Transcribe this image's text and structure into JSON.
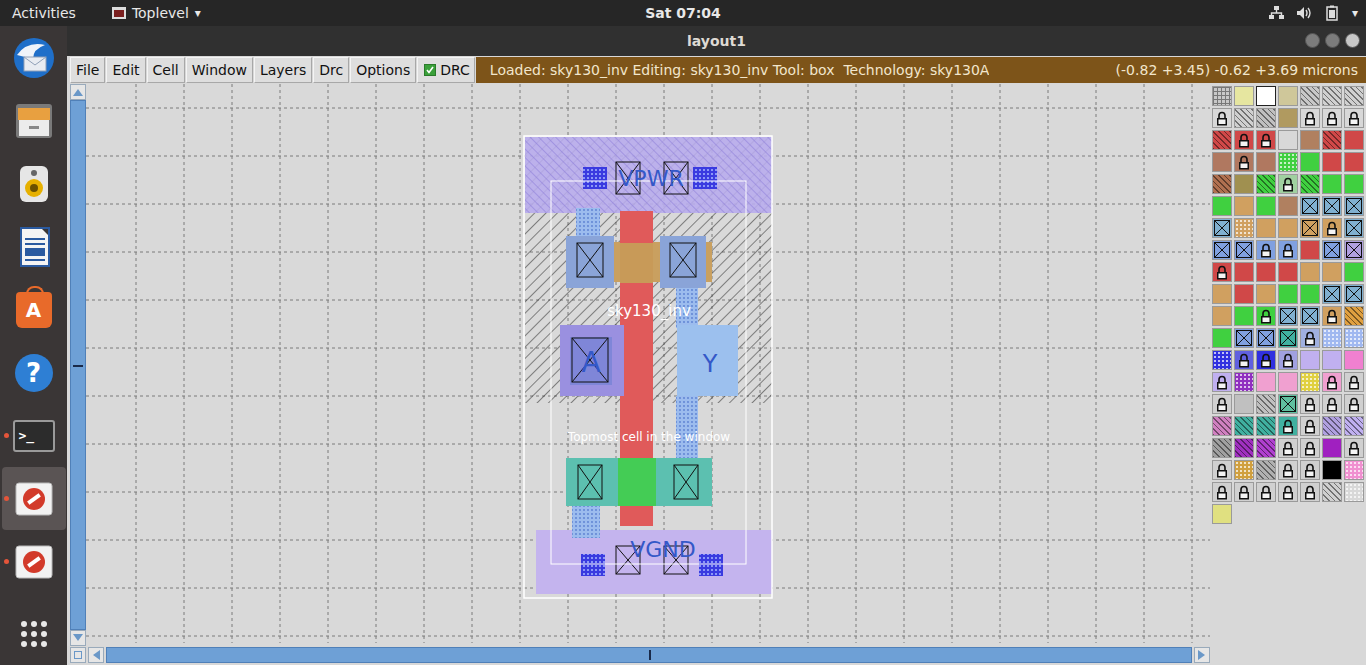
{
  "topbar": {
    "activities": "Activities",
    "app": "Toplevel",
    "app_arrow": "▾",
    "clock": "Sat 07:04",
    "menu_arrow": "▾"
  },
  "dock": [
    {
      "kind": "mail",
      "glyph": "",
      "running": false,
      "active": false
    },
    {
      "kind": "files",
      "glyph": "",
      "running": false,
      "active": false
    },
    {
      "kind": "speaker",
      "glyph": "",
      "running": false,
      "active": false
    },
    {
      "kind": "writer",
      "glyph": "",
      "running": false,
      "active": false
    },
    {
      "kind": "store",
      "glyph": "A",
      "running": false,
      "active": false
    },
    {
      "kind": "help",
      "glyph": "?",
      "running": false,
      "active": false
    },
    {
      "kind": "terminal",
      "glyph": ">_",
      "running": true,
      "active": false
    },
    {
      "kind": "blocked",
      "glyph": "",
      "running": true,
      "active": true
    },
    {
      "kind": "blocked",
      "glyph": "",
      "running": true,
      "active": false
    },
    {
      "kind": "apps",
      "glyph": "",
      "running": false,
      "active": false
    }
  ],
  "window": {
    "title": "layout1"
  },
  "menu": [
    "File",
    "Edit",
    "Cell",
    "Window",
    "Layers",
    "Drc",
    "Options"
  ],
  "drc": {
    "label": "DRC",
    "checked": true
  },
  "status": {
    "text": "Loaded: sky130_inv Editing: sky130_inv Tool: box  Technology: sky130A",
    "coords": "(-0.82 +3.45) -0.62 +3.69 microns"
  },
  "layout": {
    "power": "VPWR",
    "cell": "sky130_inv",
    "input": "A",
    "output": "Y",
    "hint": "Topmost cell in the window",
    "ground": "VGND"
  },
  "scrollbars": {
    "vertical": {
      "level": 1
    },
    "horizontal": {
      "level": 1
    }
  },
  "layers": [
    {
      "kind": "grid",
      "color": "#c8c8c8",
      "locked": false
    },
    {
      "kind": "solid",
      "color": "#e6e6a0",
      "locked": false
    },
    {
      "kind": "outline",
      "color": "#ffffff",
      "locked": false
    },
    {
      "kind": "solid",
      "color": "#cfc79a",
      "locked": false
    },
    {
      "kind": "hatch",
      "color": "#c8c8c8",
      "locked": false
    },
    {
      "kind": "hatch",
      "color": "#d0d0d0",
      "locked": false
    },
    {
      "kind": "hatch",
      "color": "#d0d0d0",
      "locked": false
    },
    {
      "kind": "solid",
      "color": "#d8d8d8",
      "locked": true
    },
    {
      "kind": "hatch",
      "color": "#d0d0d0",
      "locked": false
    },
    {
      "kind": "hatch",
      "color": "#c0c0c0",
      "locked": false
    },
    {
      "kind": "solid",
      "color": "#b09a60",
      "locked": false
    },
    {
      "kind": "solid",
      "color": "#d8d8d8",
      "locked": true
    },
    {
      "kind": "solid",
      "color": "#d8d8d8",
      "locked": true
    },
    {
      "kind": "solid",
      "color": "#d8d8d8",
      "locked": true
    },
    {
      "kind": "hatch",
      "color": "#d04848",
      "locked": false
    },
    {
      "kind": "solid",
      "color": "#d04848",
      "locked": true
    },
    {
      "kind": "solid",
      "color": "#d04848",
      "locked": true
    },
    {
      "kind": "solid",
      "color": "#d8d8d8",
      "locked": false
    },
    {
      "kind": "solid",
      "color": "#b08060",
      "locked": false
    },
    {
      "kind": "hatch",
      "color": "#d04848",
      "locked": false
    },
    {
      "kind": "solid",
      "color": "#d04848",
      "locked": false
    },
    {
      "kind": "solid",
      "color": "#b07860",
      "locked": false
    },
    {
      "kind": "solid",
      "color": "#b07860",
      "locked": true
    },
    {
      "kind": "solid",
      "color": "#b07860",
      "locked": false
    },
    {
      "kind": "dots",
      "color": "#40d040",
      "locked": false
    },
    {
      "kind": "solid",
      "color": "#40d040",
      "locked": false
    },
    {
      "kind": "solid",
      "color": "#d04848",
      "locked": false
    },
    {
      "kind": "solid",
      "color": "#d04848",
      "locked": false
    },
    {
      "kind": "hatch",
      "color": "#b07050",
      "locked": false
    },
    {
      "kind": "solid",
      "color": "#a09050",
      "locked": false
    },
    {
      "kind": "hatch",
      "color": "#40d040",
      "locked": false
    },
    {
      "kind": "solid",
      "color": "#a0d0a0",
      "locked": true
    },
    {
      "kind": "hatch",
      "color": "#40d040",
      "locked": false
    },
    {
      "kind": "solid",
      "color": "#40d040",
      "locked": false
    },
    {
      "kind": "solid",
      "color": "#40d040",
      "locked": false
    },
    {
      "kind": "solid",
      "color": "#40d040",
      "locked": false
    },
    {
      "kind": "solid",
      "color": "#d0a060",
      "locked": false
    },
    {
      "kind": "solid",
      "color": "#40d040",
      "locked": false
    },
    {
      "kind": "solid",
      "color": "#b08060",
      "locked": false
    },
    {
      "kind": "cross",
      "color": "#80b0d0",
      "locked": false
    },
    {
      "kind": "cross",
      "color": "#80b0d0",
      "locked": false
    },
    {
      "kind": "cross",
      "color": "#80b0d0",
      "locked": false
    },
    {
      "kind": "cross",
      "color": "#80b0d0",
      "locked": false
    },
    {
      "kind": "dots",
      "color": "#d0a060",
      "locked": false
    },
    {
      "kind": "solid",
      "color": "#d0a060",
      "locked": false
    },
    {
      "kind": "solid",
      "color": "#d0a060",
      "locked": false
    },
    {
      "kind": "cross",
      "color": "#d0a060",
      "locked": false
    },
    {
      "kind": "solid",
      "color": "#d0a060",
      "locked": true
    },
    {
      "kind": "cross",
      "color": "#80b0d0",
      "locked": false
    },
    {
      "kind": "cross",
      "color": "#80a0e0",
      "locked": false
    },
    {
      "kind": "cross",
      "color": "#80a0e0",
      "locked": false
    },
    {
      "kind": "solid",
      "color": "#80a0e0",
      "locked": true
    },
    {
      "kind": "solid",
      "color": "#80a0e0",
      "locked": true
    },
    {
      "kind": "solid",
      "color": "#d04848",
      "locked": false
    },
    {
      "kind": "cross",
      "color": "#80a0e0",
      "locked": false
    },
    {
      "kind": "cross",
      "color": "#b0a0e0",
      "locked": false
    },
    {
      "kind": "solid",
      "color": "#d04848",
      "locked": true
    },
    {
      "kind": "solid",
      "color": "#d04848",
      "locked": false
    },
    {
      "kind": "solid",
      "color": "#d04848",
      "locked": false
    },
    {
      "kind": "solid",
      "color": "#d04848",
      "locked": false
    },
    {
      "kind": "solid",
      "color": "#d0a060",
      "locked": false
    },
    {
      "kind": "solid",
      "color": "#d0a060",
      "locked": false
    },
    {
      "kind": "solid",
      "color": "#40d040",
      "locked": false
    },
    {
      "kind": "solid",
      "color": "#d0a060",
      "locked": false
    },
    {
      "kind": "solid",
      "color": "#d04848",
      "locked": false
    },
    {
      "kind": "solid",
      "color": "#d0a060",
      "locked": false
    },
    {
      "kind": "solid",
      "color": "#40d040",
      "locked": false
    },
    {
      "kind": "solid",
      "color": "#40d040",
      "locked": false
    },
    {
      "kind": "cross",
      "color": "#80b0d0",
      "locked": false
    },
    {
      "kind": "cross",
      "color": "#80b0d0",
      "locked": false
    },
    {
      "kind": "solid",
      "color": "#d0a060",
      "locked": false
    },
    {
      "kind": "solid",
      "color": "#40d040",
      "locked": false
    },
    {
      "kind": "solid",
      "color": "#40d040",
      "locked": true
    },
    {
      "kind": "cross",
      "color": "#80b0d0",
      "locked": false
    },
    {
      "kind": "cross",
      "color": "#80b0d0",
      "locked": false
    },
    {
      "kind": "solid",
      "color": "#d0a060",
      "locked": true
    },
    {
      "kind": "hatch",
      "color": "#e0a040",
      "locked": false
    },
    {
      "kind": "solid",
      "color": "#40d040",
      "locked": false
    },
    {
      "kind": "cross",
      "color": "#80a0e0",
      "locked": false
    },
    {
      "kind": "cross",
      "color": "#80a0e0",
      "locked": false
    },
    {
      "kind": "cross",
      "color": "#40b0a0",
      "locked": false
    },
    {
      "kind": "solid",
      "color": "#a0b0e0",
      "locked": true
    },
    {
      "kind": "dots",
      "color": "#a0b8f0",
      "locked": false
    },
    {
      "kind": "dots",
      "color": "#a0b8f0",
      "locked": false
    },
    {
      "kind": "dots",
      "color": "#3030e0",
      "locked": false
    },
    {
      "kind": "solid",
      "color": "#6060e0",
      "locked": true
    },
    {
      "kind": "solid",
      "color": "#3030e0",
      "locked": true
    },
    {
      "kind": "solid",
      "color": "#a0a0e0",
      "locked": true
    },
    {
      "kind": "solid",
      "color": "#c0b0f0",
      "locked": false
    },
    {
      "kind": "solid",
      "color": "#c0b0f0",
      "locked": false
    },
    {
      "kind": "solid",
      "color": "#f080d0",
      "locked": false
    },
    {
      "kind": "solid",
      "color": "#c0b0f0",
      "locked": true
    },
    {
      "kind": "dots",
      "color": "#9030c0",
      "locked": false
    },
    {
      "kind": "solid",
      "color": "#f0a0d0",
      "locked": false
    },
    {
      "kind": "solid",
      "color": "#f0a0d0",
      "locked": false
    },
    {
      "kind": "dots",
      "color": "#e0d040",
      "locked": false
    },
    {
      "kind": "solid",
      "color": "#f0a0d0",
      "locked": true
    },
    {
      "kind": "solid",
      "color": "#d0d0d0",
      "locked": true
    },
    {
      "kind": "solid",
      "color": "#d0d0d0",
      "locked": true
    },
    {
      "kind": "solid",
      "color": "#c0c0c0",
      "locked": false
    },
    {
      "kind": "hatch",
      "color": "#c0c0c0",
      "locked": false
    },
    {
      "kind": "cross",
      "color": "#60c0a0",
      "locked": false
    },
    {
      "kind": "solid",
      "color": "#d0d0d0",
      "locked": true
    },
    {
      "kind": "solid",
      "color": "#d0d0d0",
      "locked": true
    },
    {
      "kind": "solid",
      "color": "#d0d0d0",
      "locked": true
    },
    {
      "kind": "hatch",
      "color": "#d080c0",
      "locked": false
    },
    {
      "kind": "hatch",
      "color": "#40b0a0",
      "locked": false
    },
    {
      "kind": "hatch",
      "color": "#40b0a0",
      "locked": false
    },
    {
      "kind": "solid",
      "color": "#40b0a0",
      "locked": true
    },
    {
      "kind": "solid",
      "color": "#d0d0d0",
      "locked": true
    },
    {
      "kind": "hatch",
      "color": "#b0a0e0",
      "locked": false
    },
    {
      "kind": "hatch",
      "color": "#c0b0f0",
      "locked": false
    },
    {
      "kind": "hatch",
      "color": "#a0a0a0",
      "locked": false
    },
    {
      "kind": "hatch",
      "color": "#a030c0",
      "locked": false
    },
    {
      "kind": "hatch",
      "color": "#b040d0",
      "locked": false
    },
    {
      "kind": "solid",
      "color": "#d0d0d0",
      "locked": true
    },
    {
      "kind": "solid",
      "color": "#d0d0d0",
      "locked": true
    },
    {
      "kind": "solid",
      "color": "#a020c0",
      "locked": false
    },
    {
      "kind": "solid",
      "color": "#d0d0d0",
      "locked": true
    },
    {
      "kind": "solid",
      "color": "#d0d0d0",
      "locked": true
    },
    {
      "kind": "dots",
      "color": "#d0a040",
      "locked": false
    },
    {
      "kind": "hatch",
      "color": "#b0b0b0",
      "locked": false
    },
    {
      "kind": "solid",
      "color": "#d0d0d0",
      "locked": true
    },
    {
      "kind": "solid",
      "color": "#d0d0d0",
      "locked": true
    },
    {
      "kind": "solid",
      "color": "#000000",
      "locked": false
    },
    {
      "kind": "dots",
      "color": "#f090d0",
      "locked": false
    },
    {
      "kind": "solid",
      "color": "#d0d0d0",
      "locked": true
    },
    {
      "kind": "solid",
      "color": "#d0d0d0",
      "locked": true
    },
    {
      "kind": "solid",
      "color": "#d0d0d0",
      "locked": true
    },
    {
      "kind": "solid",
      "color": "#d0d0d0",
      "locked": true
    },
    {
      "kind": "solid",
      "color": "#d0d0d0",
      "locked": true
    },
    {
      "kind": "hatch",
      "color": "#d0d0d0",
      "locked": false
    },
    {
      "kind": "dots",
      "color": "#d8d8d8",
      "locked": false
    },
    {
      "kind": "solid",
      "color": "#e0e080",
      "locked": false
    }
  ]
}
